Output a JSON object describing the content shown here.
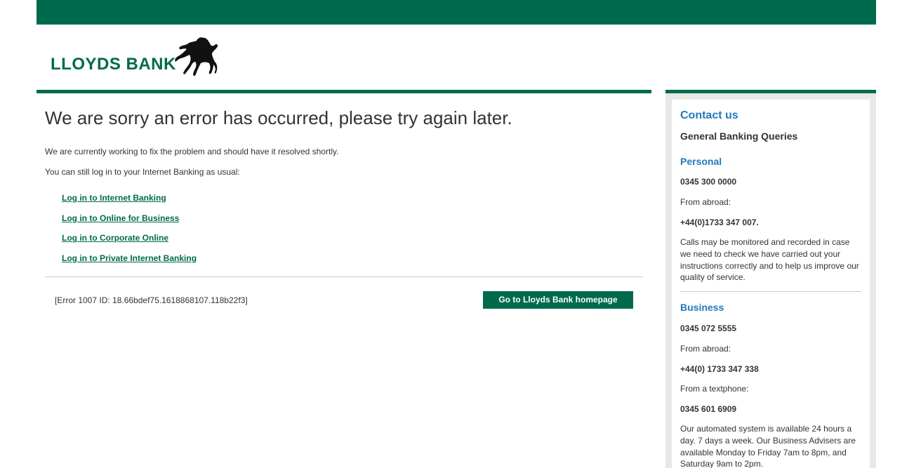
{
  "header": {
    "logo_text": "LLOYDS BANK"
  },
  "main": {
    "title": "We are sorry an error has occurred, please try again later.",
    "message": "We are currently working to fix the problem and should have it resolved shortly.",
    "login_intro": "You can still log in to your Internet Banking as usual:",
    "links": [
      "Log in to Internet Banking",
      "Log in to Online for Business",
      "Log in to Corporate Online",
      "Log in to Private Internet Banking"
    ],
    "error_id": "[Error 1007 ID: 18.66bdef75.1618868107.118b22f3]",
    "home_button": "Go to Lloyds Bank homepage"
  },
  "sidebar": {
    "title": "Contact us",
    "subtitle": "General Banking Queries",
    "personal": {
      "heading": "Personal",
      "phone": "0345 300 0000",
      "abroad_label": "From abroad:",
      "abroad_phone": "+44(0)1733 347 007.",
      "note": "Calls may be monitored and recorded in case we need to check we have carried out your instructions correctly and to help us improve our quality of service."
    },
    "business": {
      "heading": "Business",
      "phone": "0345 072 5555",
      "abroad_label": "From abroad:",
      "abroad_phone": "+44(0) 1733 347 338",
      "textphone_label": "From a textphone:",
      "textphone": "0345 601 6909",
      "note": "Our automated system is available 24 hours a day. 7 days a week. Our Business Advisers are available Monday to Friday 7am to 8pm, and Saturday 9am to 2pm."
    }
  },
  "colors": {
    "brand_green": "#006a4d",
    "link_blue": "#1e7bb8",
    "text": "#333333"
  }
}
